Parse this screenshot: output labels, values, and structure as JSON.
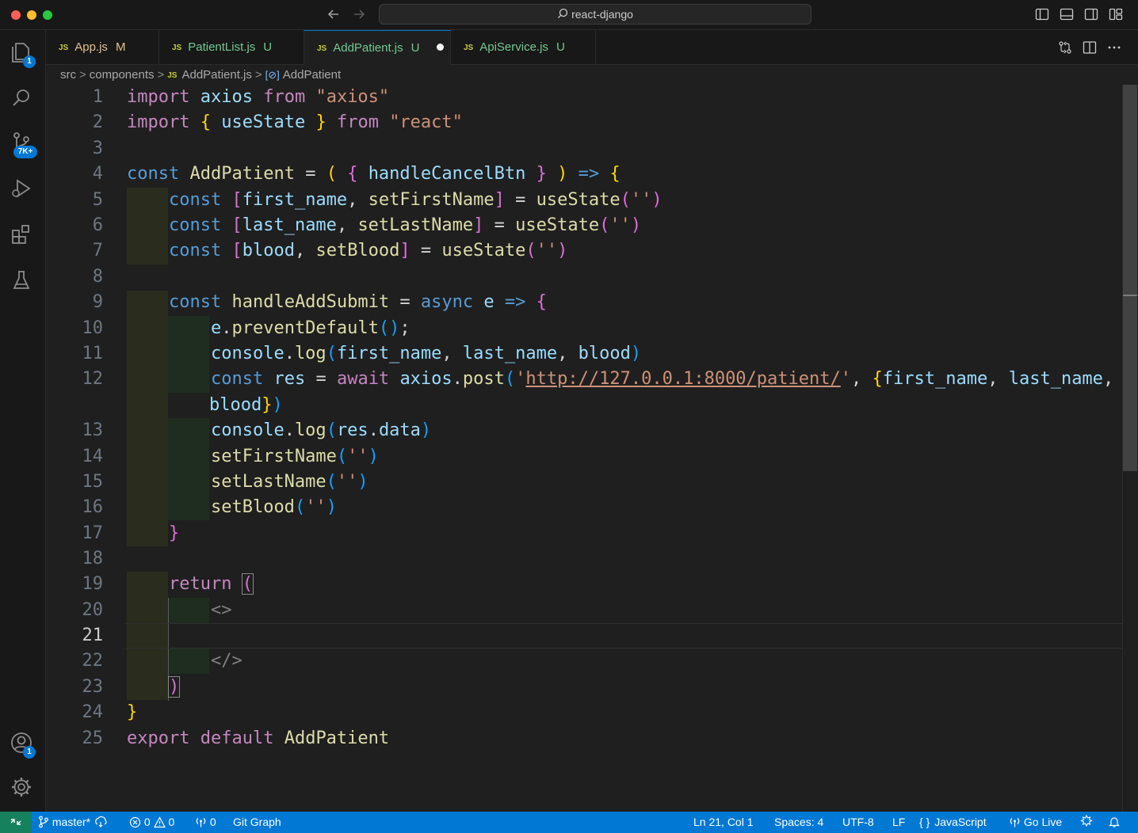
{
  "window": {
    "title": "react-django"
  },
  "activity_bar": {
    "explorer_badge": "1",
    "source_control_badge": "7K+",
    "accounts_badge": "1"
  },
  "tabs": [
    {
      "label": "App.js",
      "flag": "M",
      "lang": "JS"
    },
    {
      "label": "PatientList.js",
      "flag": "U",
      "lang": "JS"
    },
    {
      "label": "AddPatient.js",
      "flag": "U",
      "lang": "JS",
      "active": true,
      "dirty": true
    },
    {
      "label": "ApiService.js",
      "flag": "U",
      "lang": "JS"
    }
  ],
  "breadcrumb": {
    "parts": [
      "src",
      "components",
      "AddPatient.js",
      "AddPatient"
    ],
    "file_lang": "JS"
  },
  "editor": {
    "line_numbers": [
      "1",
      "2",
      "3",
      "4",
      "5",
      "6",
      "7",
      "8",
      "9",
      "10",
      "11",
      "12",
      "13",
      "14",
      "15",
      "16",
      "17",
      "18",
      "19",
      "20",
      "21",
      "22",
      "23",
      "24",
      "25"
    ],
    "current_line": "21",
    "lines": {
      "l1": [
        "import",
        "axios",
        "from",
        "\"axios\""
      ],
      "l2": [
        "import",
        "{",
        "useState",
        "}",
        "from",
        "\"react\""
      ],
      "l4": [
        "const",
        "AddPatient",
        "=",
        "(",
        "{",
        "handleCancelBtn",
        "}",
        ")",
        "=>",
        "{"
      ],
      "l5": [
        "const",
        "[",
        "first_name",
        "setFirstName",
        "]",
        "=",
        "useState",
        "(",
        "''",
        ")"
      ],
      "l6": [
        "const",
        "[",
        "last_name",
        "setLastName",
        "]",
        "=",
        "useState",
        "(",
        "''",
        ")"
      ],
      "l7": [
        "const",
        "[",
        "blood",
        "setBlood",
        "]",
        "=",
        "useState",
        "(",
        "''",
        ")"
      ],
      "l9": [
        "const",
        "handleAddSubmit",
        "=",
        "async",
        "e",
        "=>",
        "{"
      ],
      "l10": [
        "e",
        "preventDefault",
        "()",
        ";"
      ],
      "l11": [
        "console",
        "log",
        "(",
        "first_name",
        "last_name",
        "blood",
        ")"
      ],
      "l12": [
        "const",
        "res",
        "=",
        "await",
        "axios",
        "post",
        "(",
        "'",
        "http://127.0.0.1:8000/patient/",
        "'",
        "{",
        "first_name",
        "last_name"
      ],
      "l12b": [
        "blood",
        "}",
        ")"
      ],
      "l13": [
        "console",
        "log",
        "(",
        "res",
        "data",
        ")"
      ],
      "l14": [
        "setFirstName",
        "(",
        "''",
        ")"
      ],
      "l15": [
        "setLastName",
        "(",
        "''",
        ")"
      ],
      "l16": [
        "setBlood",
        "(",
        "''",
        ")"
      ],
      "l17": [
        "}"
      ],
      "l19": [
        "return",
        "("
      ],
      "l20": [
        "<>"
      ],
      "l22": [
        "</>"
      ],
      "l23": [
        ")"
      ],
      "l24": [
        "}"
      ],
      "l25": [
        "export",
        "default",
        "AddPatient"
      ]
    }
  },
  "status_bar": {
    "branch": "master*",
    "errors": "0",
    "warnings": "0",
    "ports": "0",
    "git_graph": "Git Graph",
    "cursor": "Ln 21, Col 1",
    "spaces": "Spaces: 4",
    "encoding": "UTF-8",
    "eol": "LF",
    "language": "JavaScript",
    "go_live": "Go Live"
  },
  "colors": {
    "status_bar": "#0078d4",
    "remote": "#16825d",
    "keyword": "#569cd6",
    "control": "#c586c0",
    "variable": "#9cdcfe",
    "function": "#dcdcaa",
    "string": "#ce9178"
  }
}
